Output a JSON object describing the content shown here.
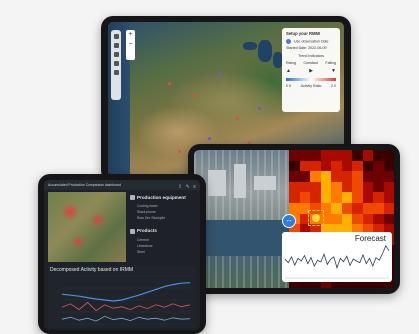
{
  "map_tablet": {
    "setup_panel": {
      "title": "Setup your RMM!",
      "observation_label": "Use observation Date",
      "date_text": "Started Date: 2022-06-09",
      "trend_title": "Trend Indicators",
      "trend_rising": "Rising",
      "trend_constant": "Constant",
      "trend_falling": "Falling",
      "scale_min": "0.5",
      "scale_mid": "Activity Ratio",
      "scale_max": "2.0"
    },
    "zoom_in": "+",
    "zoom_out": "−"
  },
  "heat_tablet": {
    "forecast_label": "Forecast",
    "forecast_series": [
      0.55,
      0.45,
      0.62,
      0.38,
      0.58,
      0.5,
      0.66,
      0.42,
      0.6,
      0.35,
      0.52,
      0.47,
      0.7,
      0.4,
      0.55,
      0.62,
      0.3,
      0.58,
      0.48,
      0.64,
      0.37,
      0.56,
      0.5,
      0.45,
      0.68,
      0.42,
      0.58,
      0.35,
      0.6,
      0.52,
      0.72,
      0.95,
      0.8
    ]
  },
  "dash_tablet": {
    "header": "Accumulated Production Comparison dashboard",
    "section_production": "Production equipment",
    "production_items": [
      "Cooling tower",
      "Stack plume",
      "Raw Ore Stockpile"
    ],
    "section_products": "Products",
    "product_items": [
      "Cement",
      "Limestone",
      "Steel"
    ],
    "chart_title": "Decomposed Activity based on IRMM",
    "chart_data": {
      "type": "line",
      "series": [
        {
          "values": [
            0.62,
            0.6,
            0.58,
            0.55,
            0.52,
            0.5,
            0.48,
            0.5,
            0.55,
            0.6,
            0.66,
            0.72,
            0.78,
            0.82,
            0.85,
            0.86
          ]
        },
        {
          "values": [
            0.35,
            0.42,
            0.3,
            0.45,
            0.28,
            0.4,
            0.33,
            0.36,
            0.3,
            0.38,
            0.32,
            0.4,
            0.35,
            0.42,
            0.36,
            0.4
          ]
        },
        {
          "values": [
            0.1,
            0.14,
            0.08,
            0.12,
            0.06,
            0.16,
            0.09,
            0.12,
            0.07,
            0.14,
            0.1,
            0.12,
            0.08,
            0.13,
            0.1,
            0.11
          ]
        }
      ]
    },
    "colors": {
      "trend": "#4c8ee8",
      "seasonal": "#e0566a",
      "residual": "#7fa3d6"
    }
  }
}
